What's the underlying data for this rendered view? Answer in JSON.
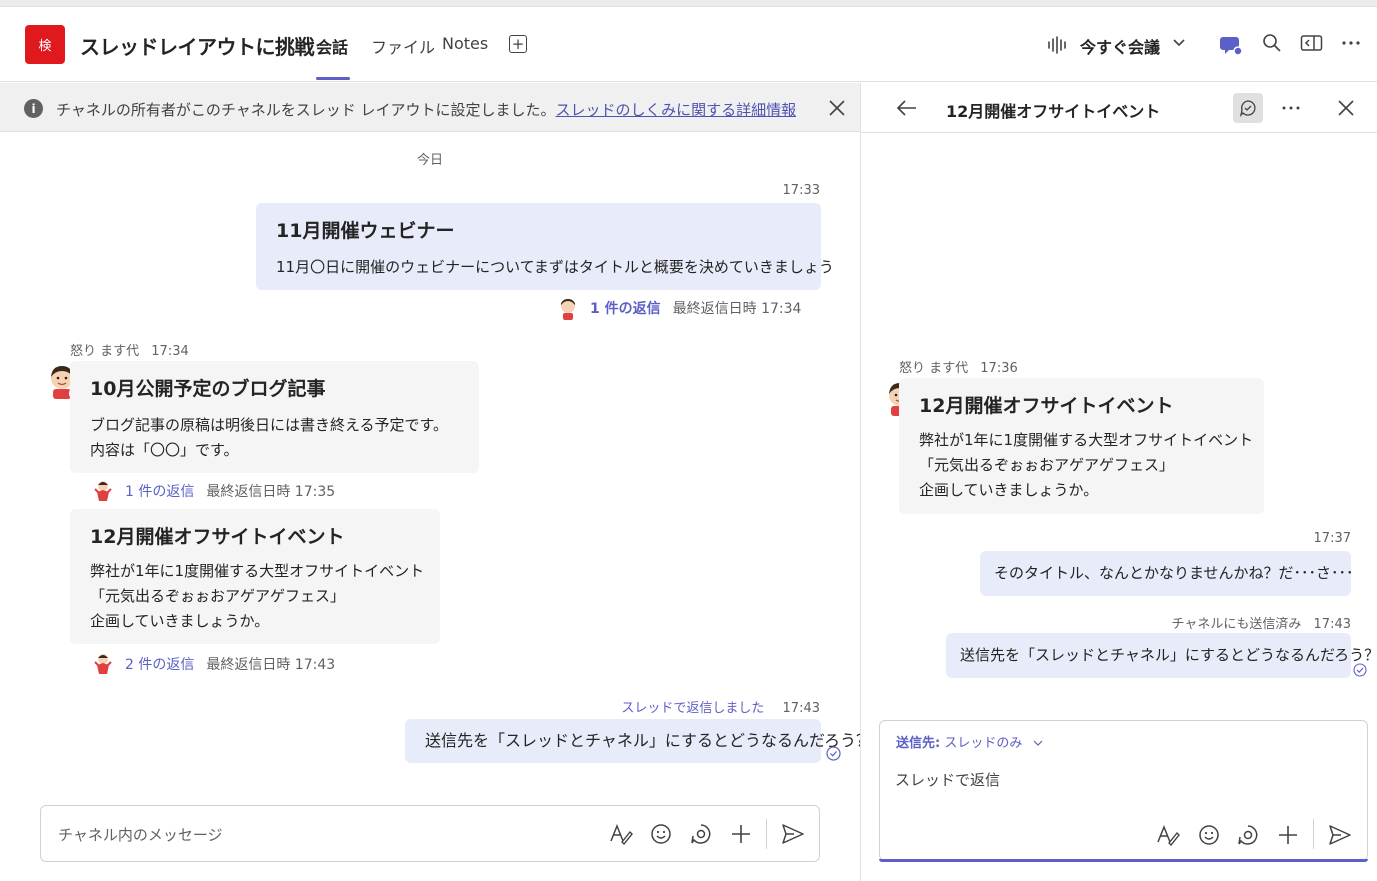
{
  "header": {
    "team_avatar_text": "検",
    "channel_title": "スレッドレイアウトに挑戦",
    "tabs": [
      {
        "label": "会話",
        "active": true
      },
      {
        "label": "ファイル",
        "active": false
      },
      {
        "label": "Notes",
        "active": false
      }
    ],
    "meet_now_label": "今すぐ会議"
  },
  "banner": {
    "text": "チャネルの所有者がこのチャネルをスレッド レイアウトに設定しました。",
    "link_text": "スレッドのしくみに関する詳細情報"
  },
  "feed": {
    "date_separator": "今日",
    "posts": [
      {
        "time": "17:33",
        "title": "11月開催ウェビナー",
        "body": [
          "11月〇日に開催のウェビナーについてまずはタイトルと概要を決めていきましょう"
        ],
        "reply_count": "1 件の返信",
        "last_reply": "最終返信日時 17:34"
      },
      {
        "author": "怒り ます代",
        "time": "17:34",
        "title": "10月公開予定のブログ記事",
        "body": [
          "ブログ記事の原稿は明後日には書き終える予定です。",
          "内容は「〇〇」です。"
        ],
        "reply_count": "1 件の返信",
        "last_reply": "最終返信日時 17:35"
      },
      {
        "title": "12月開催オフサイトイベント",
        "body": [
          "弊社が1年に1度開催する大型オフサイトイベント",
          "「元気出るぞぉぉおアゲアゲフェス」",
          "企画していきましょうか。"
        ],
        "reply_count": "2 件の返信",
        "last_reply": "最終返信日時 17:43"
      }
    ],
    "thread_reply": {
      "label": "スレッドで返信しました",
      "time": "17:43",
      "text": "送信先を「スレッドとチャネル」にするとどうなるんだろう？"
    },
    "composer_placeholder": "チャネル内のメッセージ"
  },
  "thread_pane": {
    "title": "12月開催オフサイトイベント",
    "root": {
      "author": "怒り ます代",
      "time": "17:36",
      "title": "12月開催オフサイトイベント",
      "body": [
        "弊社が1年に1度開催する大型オフサイトイベント",
        "「元気出るぞぉぉおアゲアゲフェス」",
        "企画していきましょうか。"
      ]
    },
    "replies": [
      {
        "meta": "17:37",
        "text": "そのタイトル、なんとかなりませんかね？だ･･･さ･･･"
      },
      {
        "meta_label": "チャネルにも送信済み",
        "meta": "17:43",
        "text": "送信先を「スレッドとチャネル」にするとどうなるんだろう？"
      }
    ],
    "send_to_label": "送信先:",
    "send_to_value": "スレッドのみ",
    "reply_placeholder": "スレッドで返信"
  },
  "colors": {
    "accent": "#5b5fc7",
    "team_avatar_bg": "#e0191f",
    "my_bubble": "#e8ebfa",
    "other_bubble": "#f5f5f5"
  }
}
